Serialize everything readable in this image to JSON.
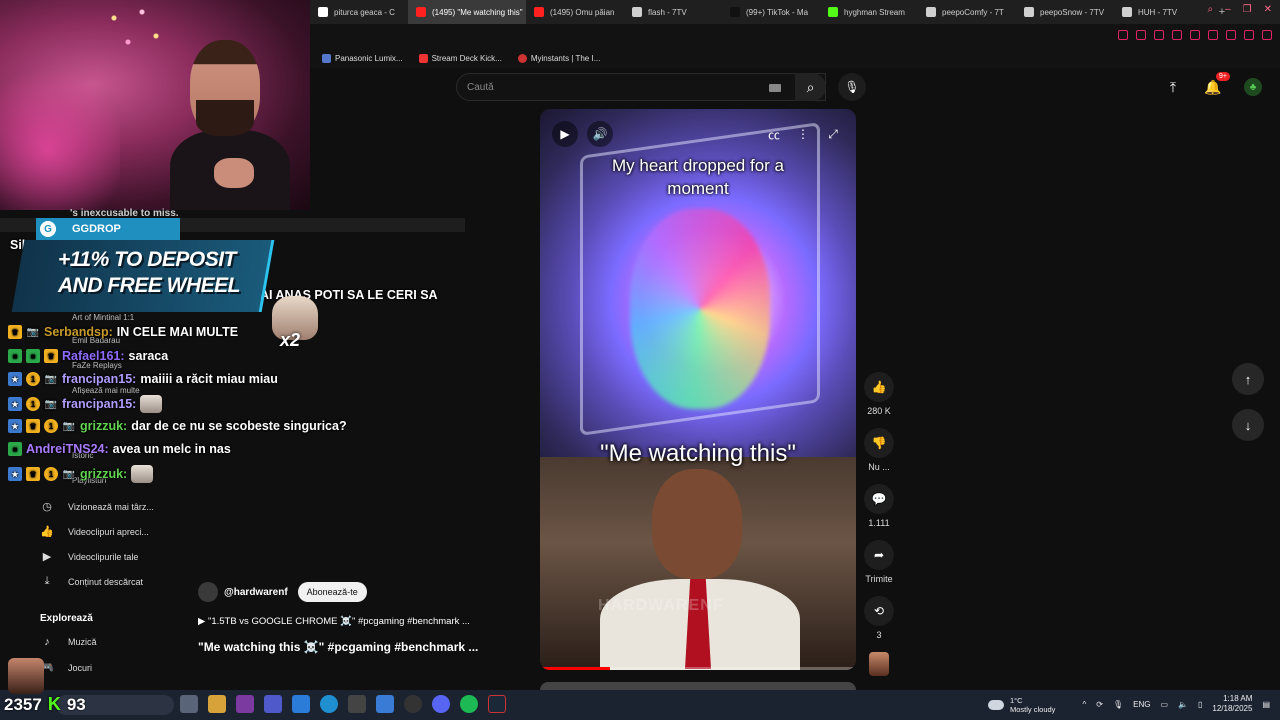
{
  "browser": {
    "tabs": [
      {
        "label": "piturca geaca - C",
        "color": "#ffffff",
        "active": false
      },
      {
        "label": "(1495) \"Me watching this\"",
        "color": "#ff2020",
        "active": true
      },
      {
        "label": "(1495) Omu păian",
        "color": "#ff2020",
        "active": false
      },
      {
        "label": "flash - 7TV",
        "color": "#cfcfcf",
        "active": false
      },
      {
        "label": "(99+) TikTok - Ma",
        "color": "#111111",
        "active": false
      },
      {
        "label": "hyghman Stream",
        "color": "#53fc18",
        "active": false
      },
      {
        "label": "peepoComfy - 7T",
        "color": "#cfcfcf",
        "active": false
      },
      {
        "label": "peepoSnow - 7TV",
        "color": "#cfcfcf",
        "active": false
      },
      {
        "label": "HUH - 7TV",
        "color": "#cfcfcf",
        "active": false
      }
    ],
    "new_tab": "+",
    "bookmarks": [
      {
        "label": "Panasonic Lumix..."
      },
      {
        "label": "Stream Deck Kick..."
      },
      {
        "label": "Myinstants | The I..."
      }
    ]
  },
  "youtube": {
    "search_placeholder": "Caută",
    "notification_count": "9+",
    "avatar_letter": "♣",
    "video": {
      "caption_top": "My heart dropped for a moment",
      "caption_bottom": "\"Me watching this\"",
      "watermark": "HARDWARENF",
      "progress": 0.22
    },
    "actions": {
      "like_count": "280 K",
      "dislike_label": "Nu ...",
      "comments_count": "1.111",
      "share_label": "Trimite",
      "remix_count": "3"
    },
    "channel": {
      "handle": "@hardwarenf",
      "subscribe_label": "Abonează-te"
    },
    "description_link": "\"1.5TB vs GOOGLE CHROME ☠️\" #pcgaming #benchmark ...",
    "title": "\"Me watching this ☠️\" #pcgaming #benchmark ..."
  },
  "sidebar": {
    "small_items": [
      "Art of Mintinal 1:1",
      "Emil Badarau",
      "FaZe Replays",
      "Afișează mai multe",
      "Istoric",
      "Playlisturi"
    ],
    "items": [
      {
        "label": "Vizionează mai târz...",
        "icon": "clock-icon",
        "glyph": "◷"
      },
      {
        "label": "Videoclipuri apreci...",
        "icon": "thumbs-up-icon",
        "glyph": "👍"
      },
      {
        "label": "Videoclipurile tale",
        "icon": "play-square-icon",
        "glyph": "▶"
      },
      {
        "label": "Conținut descărcat",
        "icon": "download-icon",
        "glyph": "⤓"
      }
    ],
    "explore_heading": "Explorează",
    "explore_items": [
      {
        "label": "Muzică",
        "icon": "music-icon",
        "glyph": "♪"
      },
      {
        "label": "Jocuri",
        "icon": "gamepad-icon",
        "glyph": "🎮"
      }
    ]
  },
  "chat": {
    "topline": "'s inexcusable to miss.",
    "partial_name": "Sil",
    "messages": [
      {
        "user": "",
        "color": "#ffffff",
        "text": "AI ANAS POTI SA LE CERI SA",
        "badges": [
          "green"
        ]
      },
      {
        "user": "Serbandsp:",
        "color": "#c79a2a",
        "text": "IN CELE MAI MULTE",
        "badges": [
          "crown",
          "cam"
        ]
      },
      {
        "user": "Rafael161:",
        "color": "#8f6bff",
        "text": "saraca",
        "badges": [
          "green",
          "green",
          "crown"
        ]
      },
      {
        "user": "francipan15:",
        "color": "#b29cff",
        "text": "maiiii a răcit miau miau",
        "badges": [
          "prime",
          "num",
          "cam"
        ]
      },
      {
        "user": "francipan15:",
        "color": "#b29cff",
        "text": "",
        "badges": [
          "prime",
          "num",
          "cam"
        ],
        "emote": true
      },
      {
        "user": "grizzuk:",
        "color": "#5fd34e",
        "text": "dar de ce nu se scobeste singurica?",
        "badges": [
          "prime",
          "crown",
          "num",
          "cam"
        ]
      },
      {
        "user": "AndreiTNS24:",
        "color": "#a97bff",
        "text": "avea un melc in nas",
        "badges": [
          "green"
        ]
      },
      {
        "user": "grizzuk:",
        "color": "#5fd34e",
        "text": "",
        "badges": [
          "prime",
          "crown",
          "num",
          "cam"
        ],
        "emote": true
      }
    ],
    "badge_number": "1"
  },
  "ad": {
    "brand": "GGDROP",
    "line1": "+11% TO DEPOSIT",
    "line2": "AND FREE WHEEL",
    "multiplier": "x2"
  },
  "overlay": {
    "viewer_count": "2357",
    "kick_count": "93"
  },
  "taskbar": {
    "weather_temp": "1°C",
    "weather_desc": "Mostly cloudy",
    "language": "ENG",
    "time": "1:18 AM",
    "date": "12/18/2025"
  }
}
